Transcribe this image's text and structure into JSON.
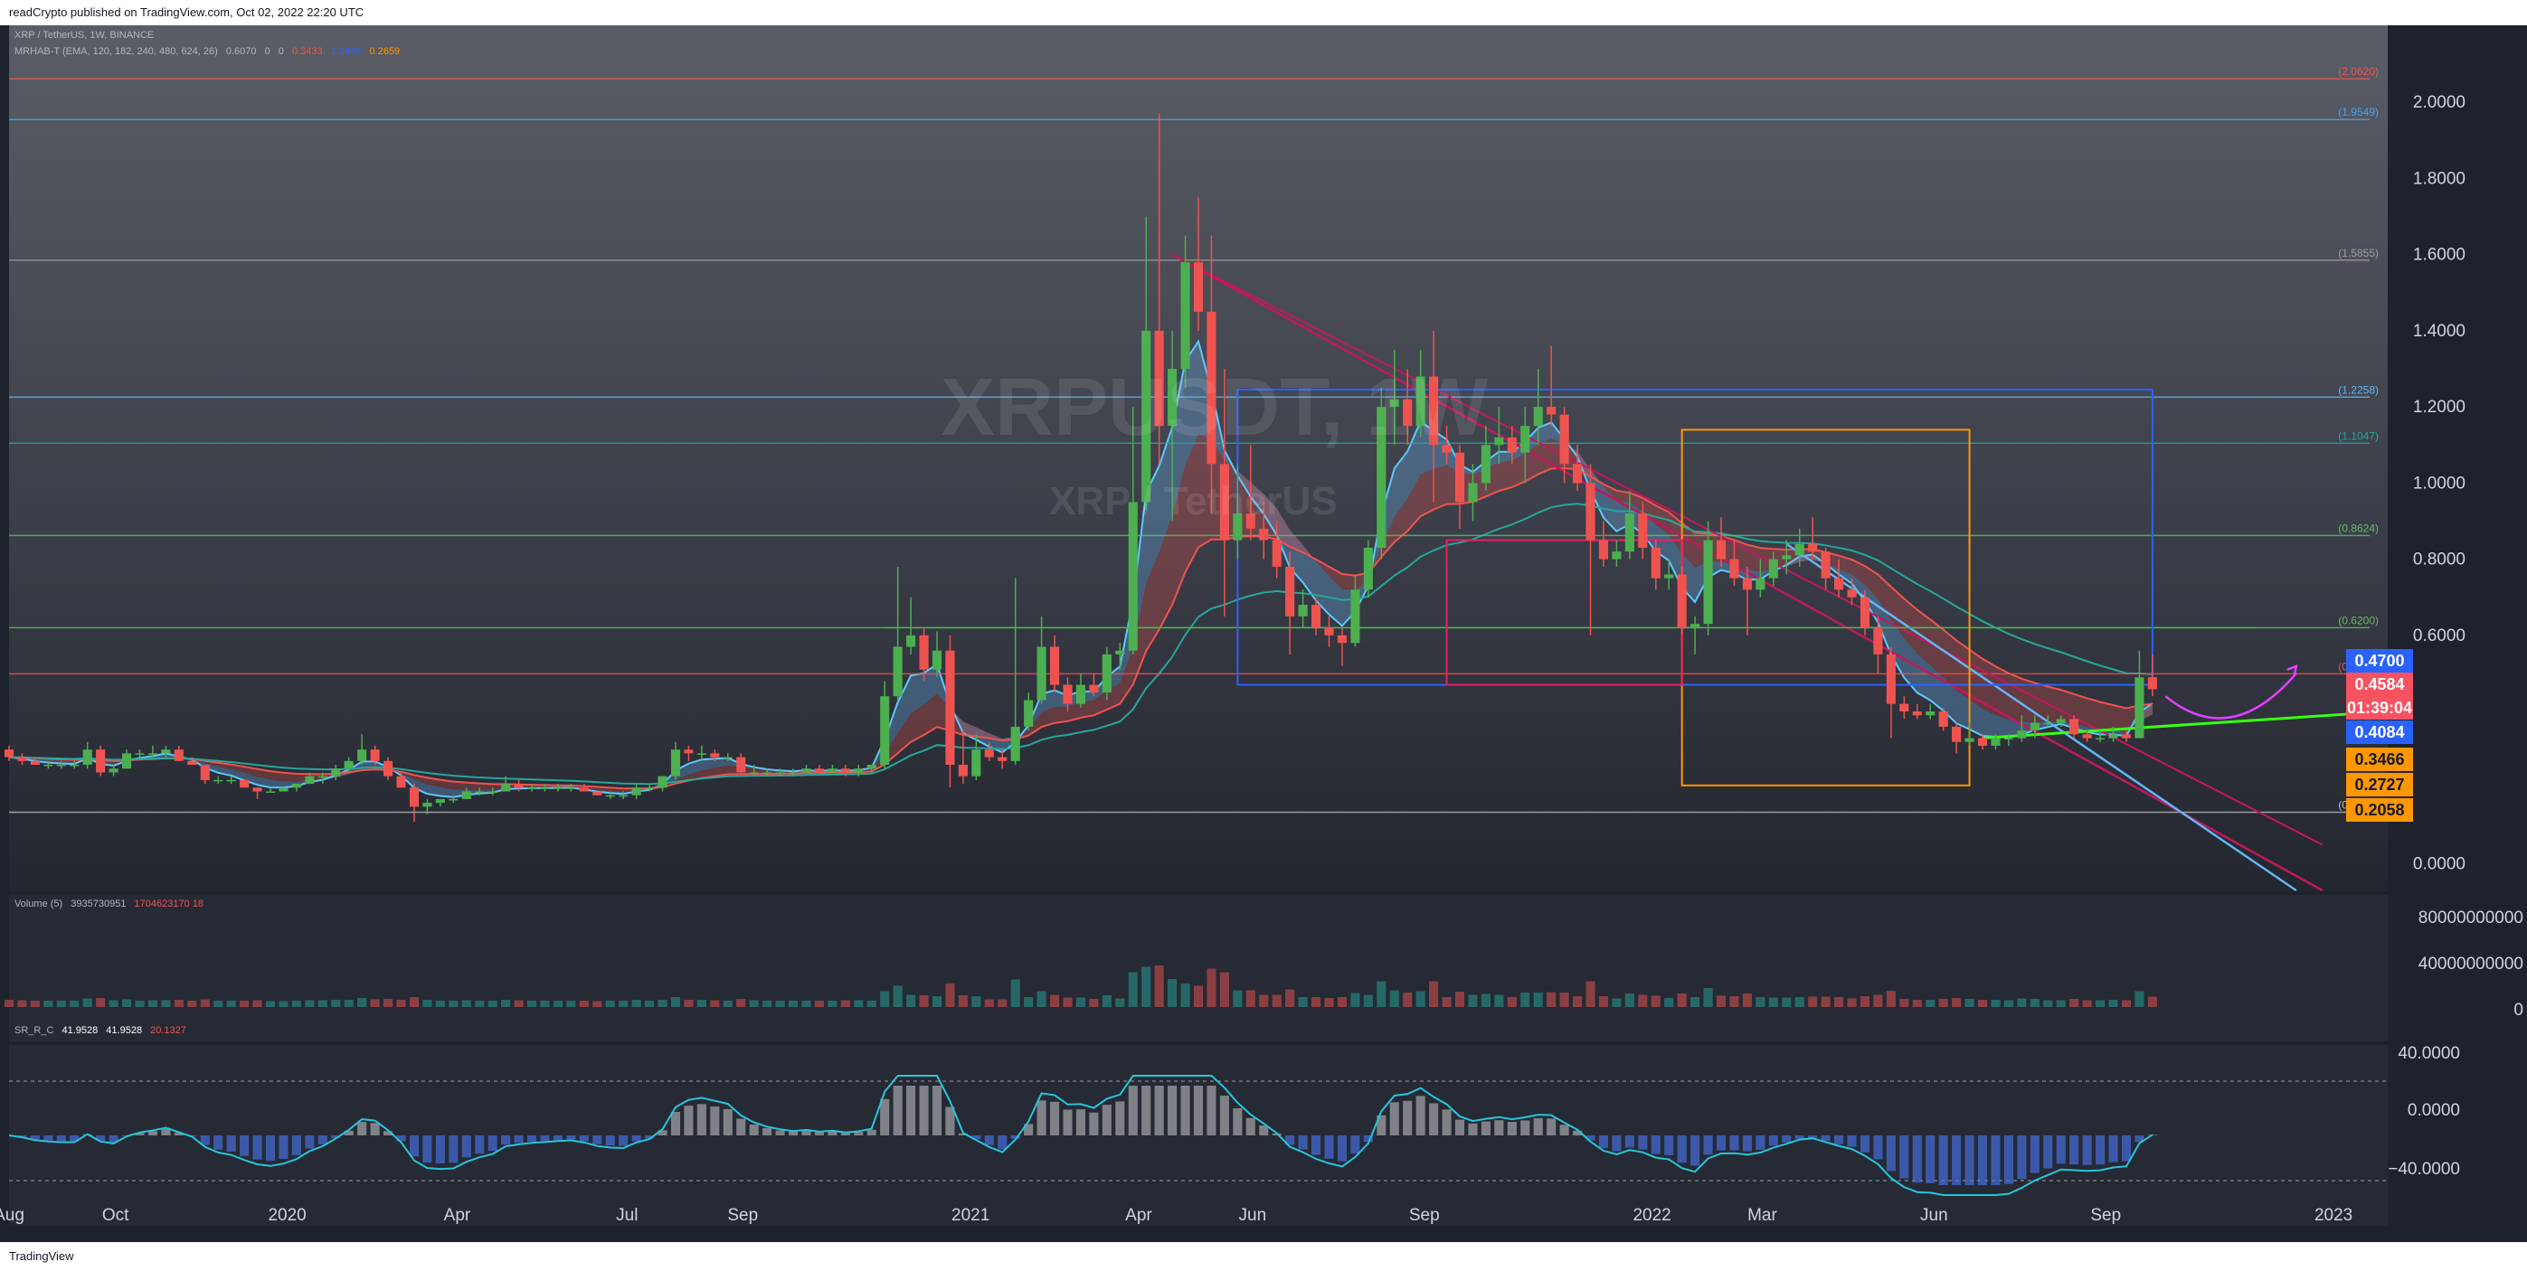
{
  "header": {
    "text": "readCrypto published on TradingView.com, Oct 02, 2022 22:20 UTC"
  },
  "footer": {
    "text": "TradingView"
  },
  "watermark": {
    "symbol": "XRPUSDT, 1W",
    "name": "XRP / TetherUS"
  },
  "legend": {
    "line1": "XRP / TetherUS, 1W, BINANCE",
    "line2": "MRHAB-T (EMA, 120, 182, 240, 480, 624, 26)",
    "line2_values": [
      "0.6070",
      "0",
      "0",
      "0.3433",
      "1.2455",
      "0.2659"
    ],
    "volume_label": "Volume (5)",
    "volume_values": [
      "3935730951",
      "1704623170 18"
    ],
    "osc_label": "SR_R_C",
    "osc_values": [
      "41.9528",
      "41.9528",
      "20.1327"
    ]
  },
  "colors": {
    "background": "#1e222d",
    "up": "#26a69a",
    "up_candle": "#4caf50",
    "down": "#ef5350",
    "accent_magenta": "#e040fb",
    "trend_green": "#39ff14",
    "blue_box": "#2962ff",
    "orange_box": "#ff9800"
  },
  "price_axis": {
    "ticks": [
      "2.0000",
      "1.8000",
      "1.6000",
      "1.4000",
      "1.2000",
      "1.0000",
      "0.8000",
      "0.6000",
      "0.0000"
    ]
  },
  "volume_axis": {
    "ticks": [
      "80000000000",
      "40000000000",
      "0"
    ]
  },
  "osc_axis": {
    "ticks": [
      "40.0000",
      "0.0000",
      "−40.0000"
    ]
  },
  "time_axis": {
    "ticks": [
      "Aug",
      "Oct",
      "2020",
      "Apr",
      "Jul",
      "Sep",
      "2021",
      "Apr",
      "Jun",
      "Sep",
      "2022",
      "Mar",
      "Jun",
      "Sep",
      "2023"
    ]
  },
  "level_labels": [
    "(2.0620)",
    "(1.9549)",
    "(1.5855)",
    "(1.2258)",
    "(1.1047)",
    "(0.8624)",
    "(0.6200)",
    "(0.4989)",
    "(0.1354)"
  ],
  "price_boxes": [
    {
      "text": "0.4700",
      "bg": "#2962ff",
      "fg": "#ffffff"
    },
    {
      "text": "0.4584",
      "bg": "#f7525f",
      "fg": "#ffffff"
    },
    {
      "text": "01:39:04",
      "bg": "#f7525f",
      "fg": "#ffffff"
    },
    {
      "text": "0.4084",
      "bg": "#2962ff",
      "fg": "#ffffff"
    },
    {
      "text": "0.3466",
      "bg": "#ff9800",
      "fg": "#131722"
    },
    {
      "text": "0.2727",
      "bg": "#ff9800",
      "fg": "#131722"
    },
    {
      "text": "0.2058",
      "bg": "#ff9800",
      "fg": "#131722"
    }
  ],
  "chart_data": {
    "type": "candlestick",
    "title": "XRP / TetherUS, 1W, BINANCE",
    "interval": "1W",
    "y_range": [
      -0.07,
      2.2
    ],
    "x_range": [
      "2019-08-05",
      "2023-01-30"
    ],
    "last_price": 0.4584,
    "horizontal_levels": [
      2.062,
      1.9549,
      1.5855,
      1.2258,
      1.1047,
      0.8624,
      0.62,
      0.4989,
      0.1354
    ],
    "candles": [
      [
        "2019-08-05",
        0.3,
        0.31,
        0.27,
        0.28
      ],
      [
        "2019-08-12",
        0.28,
        0.29,
        0.26,
        0.27
      ],
      [
        "2019-08-19",
        0.27,
        0.28,
        0.26,
        0.26
      ],
      [
        "2019-08-26",
        0.26,
        0.27,
        0.25,
        0.26
      ],
      [
        "2019-09-02",
        0.26,
        0.27,
        0.25,
        0.26
      ],
      [
        "2019-09-09",
        0.26,
        0.27,
        0.25,
        0.26
      ],
      [
        "2019-09-16",
        0.26,
        0.32,
        0.25,
        0.3
      ],
      [
        "2019-09-23",
        0.3,
        0.31,
        0.23,
        0.24
      ],
      [
        "2019-09-30",
        0.24,
        0.26,
        0.23,
        0.25
      ],
      [
        "2019-10-07",
        0.25,
        0.3,
        0.25,
        0.29
      ],
      [
        "2019-10-14",
        0.29,
        0.3,
        0.28,
        0.29
      ],
      [
        "2019-10-21",
        0.29,
        0.31,
        0.28,
        0.29
      ],
      [
        "2019-10-28",
        0.29,
        0.31,
        0.28,
        0.3
      ],
      [
        "2019-11-04",
        0.3,
        0.31,
        0.27,
        0.27
      ],
      [
        "2019-11-11",
        0.27,
        0.28,
        0.26,
        0.26
      ],
      [
        "2019-11-18",
        0.26,
        0.26,
        0.21,
        0.22
      ],
      [
        "2019-11-25",
        0.22,
        0.23,
        0.21,
        0.22
      ],
      [
        "2019-12-02",
        0.22,
        0.23,
        0.21,
        0.22
      ],
      [
        "2019-12-09",
        0.22,
        0.22,
        0.2,
        0.2
      ],
      [
        "2019-12-16",
        0.2,
        0.2,
        0.17,
        0.19
      ],
      [
        "2019-12-23",
        0.19,
        0.2,
        0.19,
        0.19
      ],
      [
        "2019-12-30",
        0.19,
        0.2,
        0.19,
        0.2
      ],
      [
        "2020-01-06",
        0.2,
        0.21,
        0.19,
        0.21
      ],
      [
        "2020-01-13",
        0.21,
        0.24,
        0.21,
        0.23
      ],
      [
        "2020-01-20",
        0.23,
        0.24,
        0.21,
        0.23
      ],
      [
        "2020-01-27",
        0.23,
        0.26,
        0.22,
        0.25
      ],
      [
        "2020-02-03",
        0.25,
        0.28,
        0.24,
        0.27
      ],
      [
        "2020-02-10",
        0.27,
        0.34,
        0.26,
        0.3
      ],
      [
        "2020-02-17",
        0.3,
        0.31,
        0.26,
        0.27
      ],
      [
        "2020-02-24",
        0.27,
        0.28,
        0.22,
        0.23
      ],
      [
        "2020-03-02",
        0.23,
        0.24,
        0.2,
        0.2
      ],
      [
        "2020-03-09",
        0.2,
        0.21,
        0.11,
        0.15
      ],
      [
        "2020-03-16",
        0.15,
        0.17,
        0.13,
        0.16
      ],
      [
        "2020-03-23",
        0.16,
        0.17,
        0.15,
        0.17
      ],
      [
        "2020-03-30",
        0.17,
        0.18,
        0.16,
        0.17
      ],
      [
        "2020-04-06",
        0.17,
        0.2,
        0.17,
        0.19
      ],
      [
        "2020-04-13",
        0.19,
        0.2,
        0.18,
        0.19
      ],
      [
        "2020-04-20",
        0.19,
        0.2,
        0.18,
        0.19
      ],
      [
        "2020-04-27",
        0.19,
        0.23,
        0.19,
        0.21
      ],
      [
        "2020-05-04",
        0.21,
        0.22,
        0.19,
        0.2
      ],
      [
        "2020-05-11",
        0.2,
        0.21,
        0.19,
        0.2
      ],
      [
        "2020-05-18",
        0.2,
        0.21,
        0.19,
        0.2
      ],
      [
        "2020-05-25",
        0.2,
        0.21,
        0.19,
        0.2
      ],
      [
        "2020-06-01",
        0.2,
        0.21,
        0.19,
        0.2
      ],
      [
        "2020-06-08",
        0.2,
        0.21,
        0.19,
        0.19
      ],
      [
        "2020-06-15",
        0.19,
        0.19,
        0.18,
        0.18
      ],
      [
        "2020-06-22",
        0.18,
        0.19,
        0.17,
        0.18
      ],
      [
        "2020-06-29",
        0.18,
        0.19,
        0.17,
        0.18
      ],
      [
        "2020-07-06",
        0.18,
        0.21,
        0.17,
        0.2
      ],
      [
        "2020-07-13",
        0.2,
        0.21,
        0.19,
        0.2
      ],
      [
        "2020-07-20",
        0.2,
        0.23,
        0.19,
        0.23
      ],
      [
        "2020-07-27",
        0.23,
        0.32,
        0.22,
        0.3
      ],
      [
        "2020-08-03",
        0.3,
        0.31,
        0.27,
        0.29
      ],
      [
        "2020-08-10",
        0.29,
        0.31,
        0.27,
        0.29
      ],
      [
        "2020-08-17",
        0.29,
        0.3,
        0.27,
        0.28
      ],
      [
        "2020-08-24",
        0.28,
        0.29,
        0.27,
        0.28
      ],
      [
        "2020-08-31",
        0.28,
        0.29,
        0.23,
        0.24
      ],
      [
        "2020-09-07",
        0.24,
        0.26,
        0.23,
        0.24
      ],
      [
        "2020-09-14",
        0.24,
        0.25,
        0.23,
        0.24
      ],
      [
        "2020-09-21",
        0.24,
        0.25,
        0.23,
        0.24
      ],
      [
        "2020-09-28",
        0.24,
        0.25,
        0.23,
        0.24
      ],
      [
        "2020-10-05",
        0.24,
        0.26,
        0.24,
        0.25
      ],
      [
        "2020-10-12",
        0.25,
        0.26,
        0.24,
        0.24
      ],
      [
        "2020-10-19",
        0.24,
        0.26,
        0.24,
        0.25
      ],
      [
        "2020-10-26",
        0.25,
        0.26,
        0.23,
        0.24
      ],
      [
        "2020-11-02",
        0.24,
        0.26,
        0.23,
        0.25
      ],
      [
        "2020-11-09",
        0.25,
        0.26,
        0.24,
        0.26
      ],
      [
        "2020-11-16",
        0.26,
        0.48,
        0.25,
        0.44
      ],
      [
        "2020-11-23",
        0.44,
        0.78,
        0.43,
        0.57
      ],
      [
        "2020-11-30",
        0.57,
        0.7,
        0.55,
        0.6
      ],
      [
        "2020-12-07",
        0.6,
        0.62,
        0.48,
        0.51
      ],
      [
        "2020-12-14",
        0.51,
        0.61,
        0.49,
        0.56
      ],
      [
        "2020-12-21",
        0.56,
        0.6,
        0.2,
        0.26
      ],
      [
        "2020-12-28",
        0.26,
        0.35,
        0.21,
        0.23
      ],
      [
        "2021-01-04",
        0.23,
        0.34,
        0.22,
        0.3
      ],
      [
        "2021-01-11",
        0.3,
        0.32,
        0.27,
        0.28
      ],
      [
        "2021-01-18",
        0.28,
        0.3,
        0.25,
        0.27
      ],
      [
        "2021-01-25",
        0.27,
        0.75,
        0.26,
        0.36
      ],
      [
        "2021-02-01",
        0.36,
        0.45,
        0.35,
        0.43
      ],
      [
        "2021-02-08",
        0.43,
        0.65,
        0.42,
        0.57
      ],
      [
        "2021-02-15",
        0.57,
        0.6,
        0.45,
        0.47
      ],
      [
        "2021-02-22",
        0.47,
        0.49,
        0.4,
        0.42
      ],
      [
        "2021-03-01",
        0.42,
        0.5,
        0.41,
        0.47
      ],
      [
        "2021-03-08",
        0.47,
        0.5,
        0.44,
        0.45
      ],
      [
        "2021-03-15",
        0.45,
        0.57,
        0.43,
        0.55
      ],
      [
        "2021-03-22",
        0.55,
        0.58,
        0.51,
        0.56
      ],
      [
        "2021-03-29",
        0.56,
        1.2,
        0.55,
        0.95
      ],
      [
        "2021-04-05",
        0.95,
        1.7,
        0.93,
        1.4
      ],
      [
        "2021-04-12",
        1.4,
        1.97,
        1.05,
        1.15
      ],
      [
        "2021-04-19",
        1.15,
        1.4,
        0.9,
        1.3
      ],
      [
        "2021-04-26",
        1.3,
        1.65,
        1.25,
        1.58
      ],
      [
        "2021-05-03",
        1.58,
        1.75,
        1.4,
        1.45
      ],
      [
        "2021-05-10",
        1.45,
        1.65,
        0.92,
        1.05
      ],
      [
        "2021-05-17",
        1.05,
        1.3,
        0.65,
        0.85
      ],
      [
        "2021-05-24",
        0.85,
        1.05,
        0.8,
        0.92
      ],
      [
        "2021-05-31",
        0.92,
        1.1,
        0.85,
        0.88
      ],
      [
        "2021-06-07",
        0.88,
        0.95,
        0.8,
        0.85
      ],
      [
        "2021-06-14",
        0.85,
        0.9,
        0.75,
        0.78
      ],
      [
        "2021-06-21",
        0.78,
        0.82,
        0.55,
        0.65
      ],
      [
        "2021-06-28",
        0.65,
        0.72,
        0.62,
        0.68
      ],
      [
        "2021-07-05",
        0.68,
        0.7,
        0.6,
        0.62
      ],
      [
        "2021-07-12",
        0.62,
        0.65,
        0.57,
        0.6
      ],
      [
        "2021-07-19",
        0.6,
        0.62,
        0.52,
        0.58
      ],
      [
        "2021-07-26",
        0.58,
        0.76,
        0.57,
        0.72
      ],
      [
        "2021-08-02",
        0.72,
        0.85,
        0.7,
        0.83
      ],
      [
        "2021-08-09",
        0.83,
        1.25,
        0.8,
        1.2
      ],
      [
        "2021-08-16",
        1.2,
        1.35,
        1.1,
        1.22
      ],
      [
        "2021-08-23",
        1.22,
        1.3,
        1.1,
        1.15
      ],
      [
        "2021-08-30",
        1.15,
        1.35,
        1.12,
        1.28
      ],
      [
        "2021-09-06",
        1.28,
        1.4,
        0.95,
        1.1
      ],
      [
        "2021-09-13",
        1.1,
        1.15,
        1.05,
        1.08
      ],
      [
        "2021-09-20",
        1.08,
        1.1,
        0.88,
        0.95
      ],
      [
        "2021-09-27",
        0.95,
        1.05,
        0.9,
        1.0
      ],
      [
        "2021-10-04",
        1.0,
        1.15,
        0.98,
        1.1
      ],
      [
        "2021-10-11",
        1.1,
        1.2,
        1.05,
        1.12
      ],
      [
        "2021-10-18",
        1.12,
        1.15,
        1.05,
        1.08
      ],
      [
        "2021-10-25",
        1.08,
        1.2,
        1.0,
        1.15
      ],
      [
        "2021-11-01",
        1.15,
        1.3,
        1.1,
        1.2
      ],
      [
        "2021-11-08",
        1.2,
        1.36,
        1.15,
        1.18
      ],
      [
        "2021-11-15",
        1.18,
        1.2,
        1.0,
        1.05
      ],
      [
        "2021-11-22",
        1.05,
        1.1,
        0.98,
        1.0
      ],
      [
        "2021-11-29",
        1.0,
        1.05,
        0.6,
        0.85
      ],
      [
        "2021-12-06",
        0.85,
        0.9,
        0.78,
        0.8
      ],
      [
        "2021-12-13",
        0.8,
        0.85,
        0.78,
        0.82
      ],
      [
        "2021-12-20",
        0.82,
        0.98,
        0.8,
        0.92
      ],
      [
        "2021-12-27",
        0.92,
        0.95,
        0.8,
        0.83
      ],
      [
        "2022-01-03",
        0.83,
        0.85,
        0.72,
        0.75
      ],
      [
        "2022-01-10",
        0.75,
        0.8,
        0.72,
        0.76
      ],
      [
        "2022-01-17",
        0.76,
        0.78,
        0.6,
        0.62
      ],
      [
        "2022-01-24",
        0.62,
        0.65,
        0.55,
        0.63
      ],
      [
        "2022-01-31",
        0.63,
        0.9,
        0.6,
        0.85
      ],
      [
        "2022-02-07",
        0.85,
        0.91,
        0.78,
        0.8
      ],
      [
        "2022-02-14",
        0.8,
        0.85,
        0.73,
        0.75
      ],
      [
        "2022-02-21",
        0.75,
        0.78,
        0.6,
        0.72
      ],
      [
        "2022-02-28",
        0.72,
        0.8,
        0.7,
        0.75
      ],
      [
        "2022-03-07",
        0.75,
        0.82,
        0.73,
        0.8
      ],
      [
        "2022-03-14",
        0.8,
        0.85,
        0.76,
        0.81
      ],
      [
        "2022-03-21",
        0.81,
        0.88,
        0.78,
        0.84
      ],
      [
        "2022-03-28",
        0.84,
        0.91,
        0.8,
        0.82
      ],
      [
        "2022-04-04",
        0.82,
        0.83,
        0.72,
        0.75
      ],
      [
        "2022-04-11",
        0.75,
        0.8,
        0.7,
        0.72
      ],
      [
        "2022-04-18",
        0.72,
        0.75,
        0.68,
        0.7
      ],
      [
        "2022-04-25",
        0.7,
        0.72,
        0.6,
        0.62
      ],
      [
        "2022-05-02",
        0.62,
        0.65,
        0.5,
        0.55
      ],
      [
        "2022-05-09",
        0.55,
        0.57,
        0.33,
        0.42
      ],
      [
        "2022-05-16",
        0.42,
        0.44,
        0.38,
        0.4
      ],
      [
        "2022-05-23",
        0.4,
        0.42,
        0.38,
        0.39
      ],
      [
        "2022-05-30",
        0.39,
        0.42,
        0.38,
        0.4
      ],
      [
        "2022-06-06",
        0.4,
        0.41,
        0.35,
        0.36
      ],
      [
        "2022-06-13",
        0.36,
        0.37,
        0.29,
        0.32
      ],
      [
        "2022-06-20",
        0.32,
        0.37,
        0.31,
        0.33
      ],
      [
        "2022-06-27",
        0.33,
        0.34,
        0.3,
        0.31
      ],
      [
        "2022-07-04",
        0.31,
        0.34,
        0.3,
        0.33
      ],
      [
        "2022-07-11",
        0.33,
        0.34,
        0.31,
        0.33
      ],
      [
        "2022-07-18",
        0.33,
        0.39,
        0.32,
        0.35
      ],
      [
        "2022-07-25",
        0.35,
        0.39,
        0.33,
        0.37
      ],
      [
        "2022-08-01",
        0.37,
        0.39,
        0.36,
        0.37
      ],
      [
        "2022-08-08",
        0.37,
        0.39,
        0.36,
        0.38
      ],
      [
        "2022-08-15",
        0.38,
        0.39,
        0.33,
        0.34
      ],
      [
        "2022-08-22",
        0.34,
        0.35,
        0.32,
        0.33
      ],
      [
        "2022-08-29",
        0.33,
        0.35,
        0.32,
        0.33
      ],
      [
        "2022-09-05",
        0.33,
        0.36,
        0.32,
        0.34
      ],
      [
        "2022-09-12",
        0.34,
        0.35,
        0.32,
        0.33
      ],
      [
        "2022-09-19",
        0.33,
        0.56,
        0.33,
        0.49
      ],
      [
        "2022-09-26",
        0.49,
        0.55,
        0.44,
        0.4584
      ]
    ]
  }
}
